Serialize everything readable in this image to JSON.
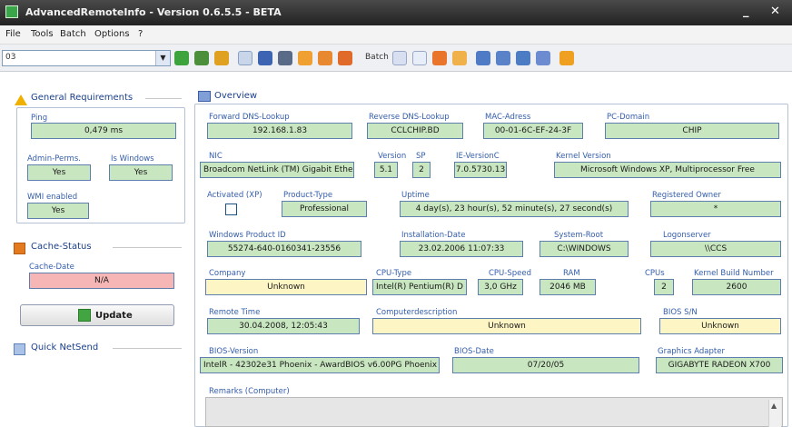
{
  "window": {
    "title": "AdvancedRemoteInfo - Version 0.6.5.5 - BETA",
    "minimize_glyph": "_",
    "close_glyph": "✕"
  },
  "menu": {
    "items": [
      "File",
      "Tools",
      "Batch",
      "Options",
      "?"
    ]
  },
  "toolbar": {
    "computer_value": "03",
    "batch_label": "Batch"
  },
  "left": {
    "general_title": "General Requirements",
    "ping_label": "Ping",
    "ping_value": "0,479 ms",
    "admin_label": "Admin-Perms.",
    "admin_value": "Yes",
    "is_windows_label": "Is Windows",
    "is_windows_value": "Yes",
    "wmi_label": "WMI enabled",
    "wmi_value": "Yes",
    "cache_title": "Cache-Status",
    "cache_date_label": "Cache-Date",
    "cache_date_value": "N/A",
    "update_label": "Update",
    "netsend_title": "Quick NetSend"
  },
  "overview": {
    "tab_label": "Overview",
    "forward_dns_label": "Forward DNS-Lookup",
    "forward_dns_value": "192.168.1.83",
    "reverse_dns_label": "Reverse DNS-Lookup",
    "reverse_dns_value": "CCLCHIP.BD",
    "mac_label": "MAC-Adress",
    "mac_value": "00-01-6C-EF-24-3F",
    "pc_domain_label": "PC-Domain",
    "pc_domain_value": "CHIP",
    "nic_label": "NIC",
    "nic_value": "Broadcom NetLink (TM) Gigabit Ether",
    "version_label": "Version",
    "version_value": "5.1",
    "sp_label": "SP",
    "sp_value": "2",
    "ie_label": "IE-VersionC",
    "ie_value": "7.0.5730.13",
    "kernel_label": "Kernel Version",
    "kernel_value": "Microsoft Windows XP, Multiprocessor Free",
    "activated_label": "Activated (XP)",
    "product_type_label": "Product-Type",
    "product_type_value": "Professional",
    "uptime_label": "Uptime",
    "uptime_value": "4 day(s), 23 hour(s), 52 minute(s), 27 second(s)",
    "owner_label": "Registered Owner",
    "owner_value": "*",
    "product_id_label": "Windows Product ID",
    "product_id_value": "55274-640-0160341-23556",
    "install_label": "Installation-Date",
    "install_value": "23.02.2006 11:07:33",
    "sysroot_label": "System-Root",
    "sysroot_value": "C:\\WINDOWS",
    "logon_label": "Logonserver",
    "logon_value": "\\\\CCS",
    "company_label": "Company",
    "company_value": "Unknown",
    "cpu_type_label": "CPU-Type",
    "cpu_type_value": "Intel(R) Pentium(R) D C",
    "cpu_speed_label": "CPU-Speed",
    "cpu_speed_value": "3,0 GHz",
    "ram_label": "RAM",
    "ram_value": "2046 MB",
    "cpus_label": "CPUs",
    "cpus_value": "2",
    "kernel_build_label": "Kernel Build Number",
    "kernel_build_value": "2600",
    "remote_time_label": "Remote Time",
    "remote_time_value": "30.04.2008, 12:05:43",
    "computer_desc_label": "Computerdescription",
    "computer_desc_value": "Unknown",
    "bios_sn_label": "BIOS S/N",
    "bios_sn_value": "Unknown",
    "bios_version_label": "BIOS-Version",
    "bios_version_value": "IntelR - 42302e31 Phoenix - AwardBIOS v6.00PG Phoenix",
    "bios_date_label": "BIOS-Date",
    "bios_date_value": "07/20/05",
    "graphics_label": "Graphics Adapter",
    "graphics_value": "GIGABYTE RADEON X700",
    "remarks_label": "Remarks (Computer)"
  },
  "colors": {
    "value_green": "#c8e6bf",
    "value_yellow": "#fdf5c4",
    "value_pink": "#f6b6b6",
    "label_blue": "#335dab",
    "titlebar": "#2f2f2f"
  }
}
